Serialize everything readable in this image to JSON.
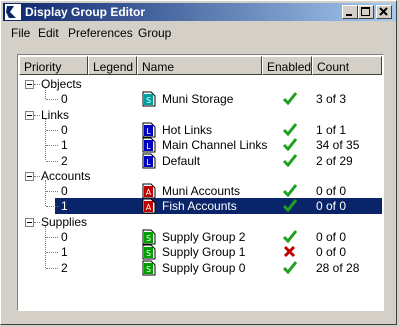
{
  "window": {
    "title": "Display Group Editor"
  },
  "menu": [
    "File",
    "Edit",
    "Preferences",
    "Group"
  ],
  "columns": [
    "Priority",
    "Legend",
    "Name",
    "Enabled",
    "Count"
  ],
  "groups": [
    {
      "label": "Objects",
      "rows": [
        {
          "priority": "0",
          "name": "Muni Storage",
          "enabled": true,
          "count": "3 of 3",
          "icon_color": "#00a0a0",
          "icon_letter": "S"
        }
      ]
    },
    {
      "label": "Links",
      "rows": [
        {
          "priority": "0",
          "name": "Hot Links",
          "enabled": true,
          "count": "1 of 1",
          "icon_color": "#0000c0",
          "icon_letter": "L"
        },
        {
          "priority": "1",
          "name": "Main Channel Links",
          "enabled": true,
          "count": "34 of 35",
          "icon_color": "#0000c0",
          "icon_letter": "L"
        },
        {
          "priority": "2",
          "name": "Default",
          "enabled": true,
          "count": "2 of 29",
          "icon_color": "#0000c0",
          "icon_letter": "L"
        }
      ]
    },
    {
      "label": "Accounts",
      "rows": [
        {
          "priority": "0",
          "name": "Muni Accounts",
          "enabled": true,
          "count": "0 of 0",
          "icon_color": "#c00000",
          "icon_letter": "A"
        },
        {
          "priority": "1",
          "name": "Fish Accounts",
          "enabled": true,
          "count": "0 of 0",
          "icon_color": "#c00000",
          "icon_letter": "A",
          "selected": true
        }
      ]
    },
    {
      "label": "Supplies",
      "rows": [
        {
          "priority": "0",
          "name": "Supply Group 2",
          "enabled": true,
          "count": "0 of 0",
          "icon_color": "#00a000",
          "icon_letter": "S"
        },
        {
          "priority": "1",
          "name": "Supply Group 1",
          "enabled": false,
          "count": "0 of 0",
          "icon_color": "#00a000",
          "icon_letter": "S"
        },
        {
          "priority": "2",
          "name": "Supply Group 0",
          "enabled": true,
          "count": "28 of 28",
          "icon_color": "#00a000",
          "icon_letter": "S"
        }
      ]
    }
  ],
  "colors": {
    "title_start": "#0a246a",
    "selection": "#0a246a",
    "check": "#20a020",
    "cross": "#c00000"
  }
}
